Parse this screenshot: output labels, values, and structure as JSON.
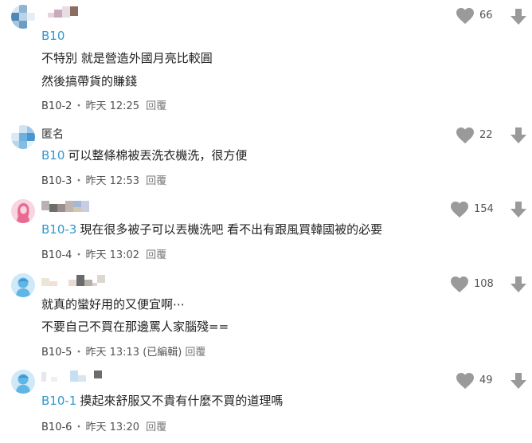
{
  "comments": [
    {
      "author": "",
      "reply_to": "B10",
      "lines": [
        "不特別 就是營造外國月亮比較圓",
        "然後搞帶貨的賺錢"
      ],
      "floor": "B10-2",
      "time": "昨天 12:25",
      "edited": "",
      "reply_label": "回覆",
      "likes": "66",
      "avatar_icon": "pixelated-avatar-icon"
    },
    {
      "author": "匿名",
      "reply_to": "B10",
      "lines": [
        "可以整條棉被丟洗衣機洗，很方便"
      ],
      "floor": "B10-3",
      "time": "昨天 12:53",
      "edited": "",
      "reply_label": "回覆",
      "likes": "22",
      "avatar_icon": "pixelated-avatar-icon"
    },
    {
      "author": "",
      "reply_to": "B10-3",
      "lines": [
        "現在很多被子可以丟機洗吧 看不出有跟風買韓國被的必要"
      ],
      "floor": "B10-4",
      "time": "昨天 13:02",
      "edited": "",
      "reply_label": "回覆",
      "likes": "154",
      "avatar_icon": "female-avatar-icon"
    },
    {
      "author": "",
      "reply_to": "",
      "lines": [
        "就真的蠻好用的又便宜啊⋯",
        "不要自己不買在那邊罵人家腦殘=="
      ],
      "floor": "B10-5",
      "time": "昨天 13:13",
      "edited": "(已編輯)",
      "reply_label": "回覆",
      "likes": "108",
      "avatar_icon": "male-avatar-icon"
    },
    {
      "author": "",
      "reply_to": "B10-1",
      "lines": [
        "摸起來舒服又不貴有什麼不買的道理嗎"
      ],
      "floor": "B10-6",
      "time": "昨天 13:20",
      "edited": "",
      "reply_label": "回覆",
      "likes": "49",
      "avatar_icon": "male-avatar-icon"
    }
  ],
  "meta_separator": "・",
  "colors": {
    "reply_tag": "#3397cf",
    "icon_gray": "#9a9a9a",
    "avatar_blue": "#5fb6e6",
    "avatar_pink": "#e86a93"
  }
}
